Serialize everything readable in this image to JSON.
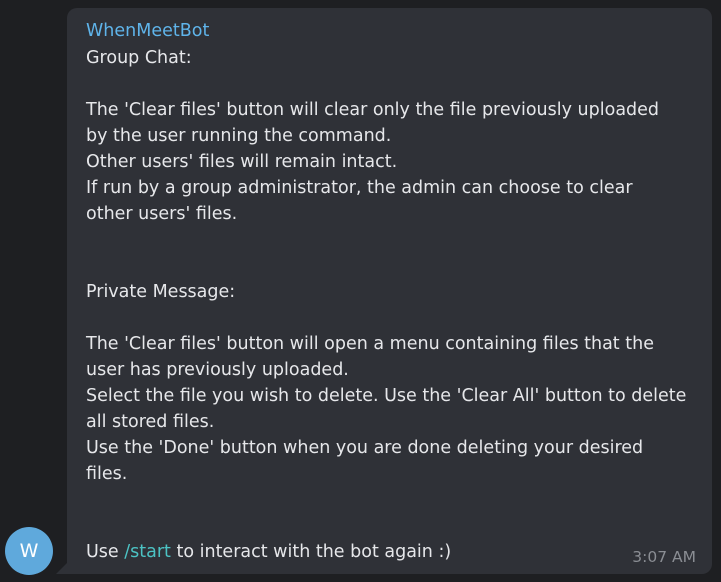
{
  "avatar": {
    "letter": "W"
  },
  "message": {
    "sender": "WhenMeetBot",
    "lines": [
      "Group Chat:",
      "",
      "The 'Clear files' button will clear only the file previously uploaded",
      "by the user running the command.",
      "Other users' files will remain intact.",
      "If run by a group administrator, the admin can choose to clear",
      "other users' files.",
      "",
      "",
      "Private Message:",
      "",
      "The 'Clear files' button will open a menu containing files that the",
      "user has previously uploaded.",
      "Select the file you wish to delete. Use the 'Clear All' button to delete",
      "all stored files.",
      "Use the 'Done' button when you are done deleting your desired",
      "files.",
      "",
      ""
    ],
    "last_line": {
      "prefix": "Use ",
      "command": "/start",
      "suffix": " to interact with the bot again :)"
    },
    "time": "3:07 AM"
  },
  "colors": {
    "background": "#1e1f22",
    "bubble": "#2f3137",
    "sender": "#5fb4ea",
    "text": "#e6e7ea",
    "link": "#4cc3c4",
    "timestamp": "#8a8d93",
    "avatar": "#5fa9dc"
  }
}
